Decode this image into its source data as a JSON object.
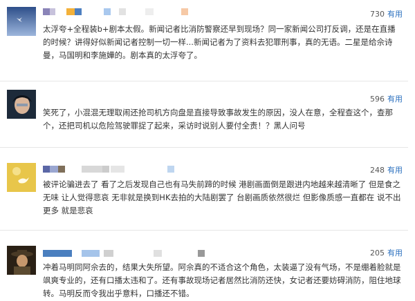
{
  "comments": [
    {
      "likes_count": "730",
      "likes_label": "有用",
      "text": "太浮夸+全程装b+剧本太假。新闻记者比消防警察还早到现场？同一家新闻公司打反调，还是在直播的时候？讲得好似新闻记者控制一切一样...新闻记者为了资料去犯罪刑事，真的无语。二星是给佘诗曼，马国明和李施嬅的。剧本真的太浮夸了。",
      "username_color": "#9aa9c8"
    },
    {
      "likes_count": "596",
      "likes_label": "有用",
      "text": "笑死了，小混混无理取闹还抢司机方向盘是直接导致事故发生的原因，没人在意，全程查这个，查那个，还把司机以危险驾驶罪捉了起来，采访时说别人要付全责！？黑人问号",
      "username_color": "#bbbbbb"
    },
    {
      "likes_count": "248",
      "likes_label": "有用",
      "text": "被评论骗进去了 看了之后发现自己也有马失前蹄的时候 港剧画面倒是跟进内地越来越清晰了 但是食之无味 让人觉得悲哀 无非就是换到HK去拍的大陆剧罢了 台剧画质依然很烂 但影像质感一直都在 说不出更多 就是悲哀",
      "username_color": "#6b78a8"
    },
    {
      "likes_count": "205",
      "likes_label": "有用",
      "text": "冲着马明同阿佘去的，结果大失所望。阿佘真的不适合这个角色，太装逼了没有气场，不是绷着脸就是飒爽专业的，还有口播太违和了。还有事故现场记者居然比消防还快，女记者还要妨碍消防，阻住地球转。马明反而令我出乎意料，口播还不错。",
      "username_color": "#4a7fbf"
    }
  ],
  "icons": [
    "bird-avatar-icon",
    "portrait-avatar-icon",
    "sparrow-avatar-icon",
    "cowboy-avatar-icon"
  ]
}
